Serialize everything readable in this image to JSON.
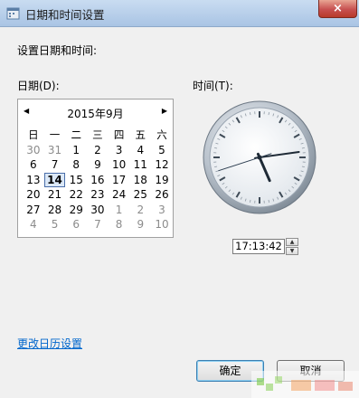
{
  "window": {
    "title": "日期和时间设置",
    "close_label": "×"
  },
  "content": {
    "label": "设置日期和时间:"
  },
  "date": {
    "label": "日期(D):",
    "prev_icon": "◀",
    "next_icon": "▶",
    "month_title": "2015年9月",
    "weekdays": [
      "日",
      "一",
      "二",
      "三",
      "四",
      "五",
      "六"
    ],
    "days": [
      [
        "30",
        "31",
        "1",
        "2",
        "3",
        "4",
        "5"
      ],
      [
        "6",
        "7",
        "8",
        "9",
        "10",
        "11",
        "12"
      ],
      [
        "13",
        "14",
        "15",
        "16",
        "17",
        "18",
        "19"
      ],
      [
        "20",
        "21",
        "22",
        "23",
        "24",
        "25",
        "26"
      ],
      [
        "27",
        "28",
        "29",
        "30",
        "1",
        "2",
        "3"
      ],
      [
        "4",
        "5",
        "6",
        "7",
        "8",
        "9",
        "10"
      ]
    ],
    "selected_day": "14"
  },
  "time": {
    "label": "时间(T):",
    "value": "17:13:42",
    "clock": {
      "hour": 17,
      "minute": 13,
      "second": 42
    }
  },
  "link": {
    "change_calendar": "更改日历设置"
  },
  "buttons": {
    "ok": "确定",
    "cancel": "取消"
  },
  "colors": {
    "link": "#0066cc",
    "titlebar": "#b8d0ec",
    "close": "#c75050"
  }
}
